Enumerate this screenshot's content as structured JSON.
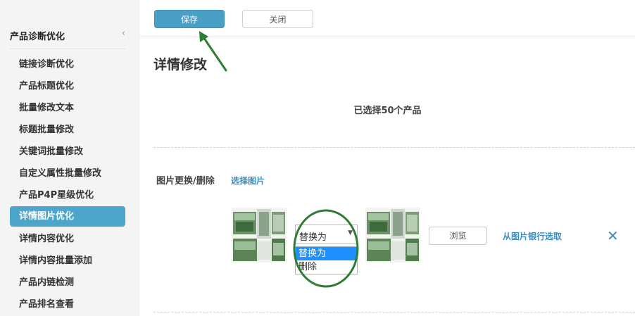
{
  "sidebar": {
    "title": "产品诊断优化",
    "collapse_icon": "‹",
    "items": [
      {
        "label": "链接诊断优化"
      },
      {
        "label": "产品标题优化"
      },
      {
        "label": "批量修改文本"
      },
      {
        "label": "标题批量修改"
      },
      {
        "label": "关键词批量修改"
      },
      {
        "label": "自定义属性批量修改"
      },
      {
        "label": "产品P4P星级优化"
      },
      {
        "label": "详情图片优化",
        "active": true
      },
      {
        "label": "详情内容优化"
      },
      {
        "label": "详情内容批量添加"
      },
      {
        "label": "产品内链检测"
      },
      {
        "label": "产品排名查看"
      }
    ]
  },
  "toolbar": {
    "save_label": "保存",
    "close_label": "关闭"
  },
  "main": {
    "title": "详情修改",
    "selected_count_text": "已选择50个产品",
    "section_label": "图片更换/删除",
    "select_image_link": "选择图片",
    "action_select": {
      "value": "替换为",
      "options": [
        "替换为",
        "删除"
      ]
    },
    "browse_label": "浏览",
    "bank_link": "从图片银行选取",
    "remove_icon": "✕"
  },
  "colors": {
    "accent": "#4a9fc6",
    "active_nav": "#4ca6cc",
    "link": "#3a8ebd",
    "annotation_green": "#2e7d32"
  }
}
